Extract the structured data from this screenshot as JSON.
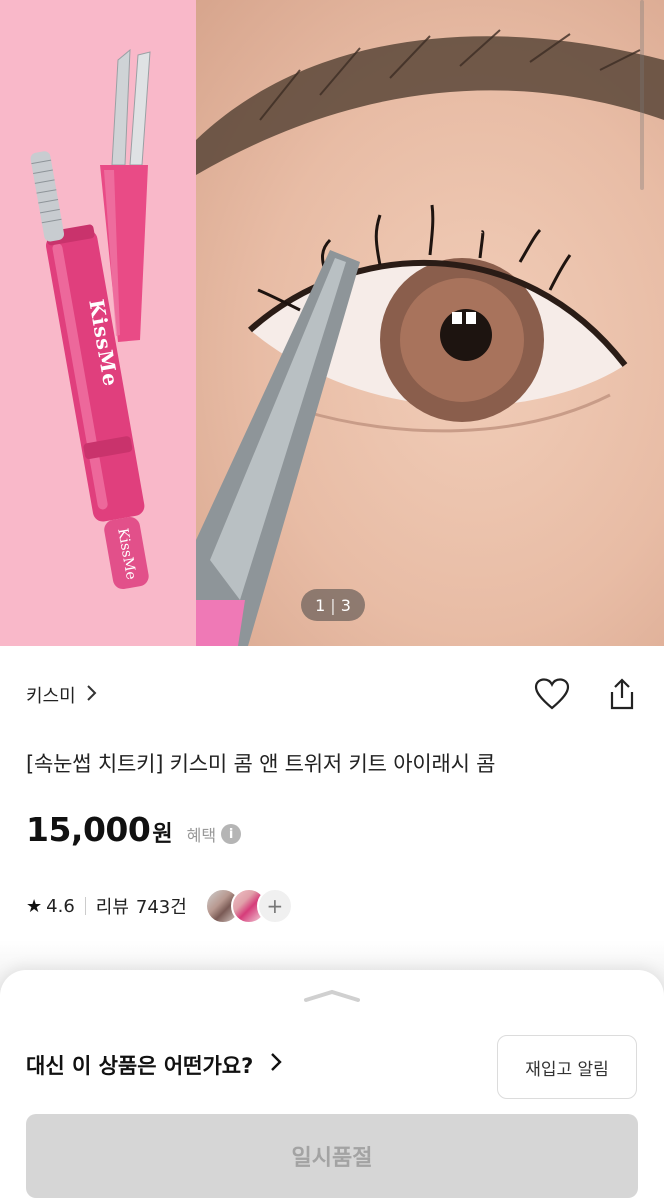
{
  "gallery": {
    "current_page": "1",
    "separator": "|",
    "total_pages": "3",
    "brand_print": "KissMe"
  },
  "product": {
    "brand": "키스미",
    "title": "[속눈썹 치트키] 키스미 콤 앤 트위저 키트 아이래시 콤",
    "price": "15,000",
    "price_unit": "원",
    "benefit_label": "혜택",
    "rating": "4.6",
    "review_label": "리뷰",
    "review_count": "743건"
  },
  "icons": {
    "brand_chevron": "chevron-right-icon",
    "wishlist": "heart-icon",
    "share": "share-icon",
    "info": "info-icon",
    "star": "star-icon",
    "more": "plus-icon"
  },
  "review_thumbs": {
    "more_symbol": "+"
  },
  "bottom_sheet": {
    "suggestion_label": "대신 이 상품은 어떤가요?",
    "restock_button": "재입고 알림",
    "soldout_button": "일시품절"
  },
  "colors": {
    "hero_pink": "#f9b8c9",
    "product_pink": "#e8437f",
    "soldout_bg": "#d6d6d6",
    "soldout_text": "#a3a3a3"
  }
}
